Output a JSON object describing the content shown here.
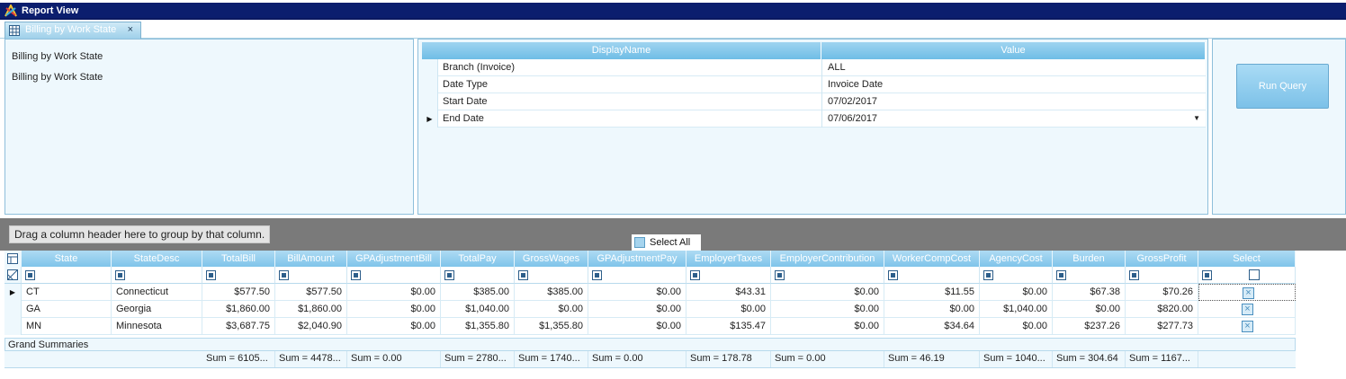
{
  "window": {
    "title": "Report View"
  },
  "tab": {
    "label": "Billing by Work State",
    "close": "×"
  },
  "report": {
    "line1": "Billing by Work State",
    "line2": "Billing by Work State"
  },
  "params": {
    "headers": [
      "DisplayName",
      "Value"
    ],
    "rows": [
      {
        "name": "Branch (Invoice)",
        "value": "ALL"
      },
      {
        "name": "Date Type",
        "value": "Invoice Date"
      },
      {
        "name": "Start Date",
        "value": "07/02/2017"
      },
      {
        "name": "End Date",
        "value": "07/06/2017"
      }
    ]
  },
  "run_query": "Run Query",
  "group_hint": "Drag a column header here to group by that column.",
  "select_all": "Select All",
  "grid": {
    "headers": [
      "State",
      "StateDesc",
      "TotalBill",
      "BillAmount",
      "GPAdjustmentBill",
      "TotalPay",
      "GrossWages",
      "GPAdjustmentPay",
      "EmployerTaxes",
      "EmployerContribution",
      "WorkerCompCost",
      "AgencyCost",
      "Burden",
      "GrossProfit",
      "Select"
    ],
    "rows": [
      [
        "CT",
        "Connecticut",
        "$577.50",
        "$577.50",
        "$0.00",
        "$385.00",
        "$385.00",
        "$0.00",
        "$43.31",
        "$0.00",
        "$11.55",
        "$0.00",
        "$67.38",
        "$70.26"
      ],
      [
        "GA",
        "Georgia",
        "$1,860.00",
        "$1,860.00",
        "$0.00",
        "$1,040.00",
        "$0.00",
        "$0.00",
        "$0.00",
        "$0.00",
        "$0.00",
        "$1,040.00",
        "$0.00",
        "$820.00"
      ],
      [
        "MN",
        "Minnesota",
        "$3,687.75",
        "$2,040.90",
        "$0.00",
        "$1,355.80",
        "$1,355.80",
        "$0.00",
        "$135.47",
        "$0.00",
        "$34.64",
        "$0.00",
        "$237.26",
        "$277.73"
      ]
    ],
    "grand_summaries_label": "Grand Summaries",
    "sums": [
      "Sum = 6105...",
      "Sum = 4478...",
      "Sum = 0.00",
      "Sum = 2780...",
      "Sum = 1740...",
      "Sum = 0.00",
      "Sum = 178.78",
      "Sum = 0.00",
      "Sum = 46.19",
      "Sum = 1040...",
      "Sum = 304.64",
      "Sum = 1167..."
    ]
  },
  "icons": {
    "row_indicator": "triangle-right",
    "dropdown": "triangle-down",
    "select_box": "x-box"
  }
}
